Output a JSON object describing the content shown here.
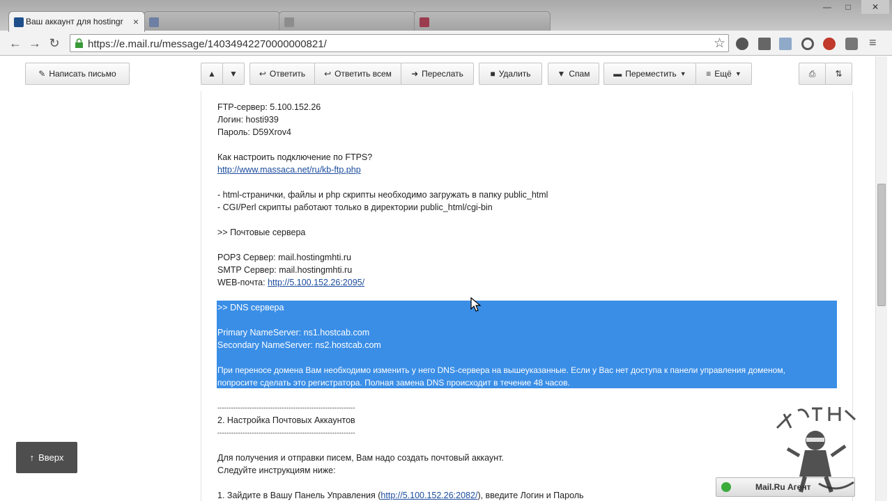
{
  "browser": {
    "active_tab_title": "Ваш аккаунт для hostingr",
    "tab_close": "×",
    "url": "https://e.mail.ru/message/14034942270000000821/"
  },
  "mail_toolbar": {
    "compose": "Написать письмо",
    "reply": "Ответить",
    "reply_all": "Ответить всем",
    "forward": "Переслать",
    "delete": "Удалить",
    "spam": "Спам",
    "move": "Переместить",
    "more": "Ещё"
  },
  "message": {
    "ftp_server": "FTP-сервер: 5.100.152.26",
    "login": "Логин: hosti939",
    "password": "Пароль: D59Xrov4",
    "ftps_question": "Как настроить подключение по FTPS?",
    "ftps_link": "http://www.massaca.net/ru/kb-ftp.php",
    "html_note": "- html-странички, файлы и php скрипты необходимо загружать в папку public_html",
    "cgi_note": "- CGI/Perl скрипты работают только в директории public_html/cgi-bin",
    "mail_servers_heading": ">> Почтовые сервера",
    "pop3": "POP3 Сервер: mail.hostingmhti.ru",
    "smtp": "SMTP Сервер: mail.hostingmhti.ru",
    "webmail_label": "WEB-почта: ",
    "webmail_link": "http://5.100.152.26:2095/",
    "dns_heading": ">> DNS сервера",
    "primary_ns": "Primary NameServer: ns1.hostcab.com",
    "secondary_ns": "Secondary NameServer: ns2.hostcab.com",
    "dns_note_1": "При переносе домена Вам необходимо изменить у него DNS-сервера на вышеуказанные. Если у Вас нет доступа к панели управления доменом,",
    "dns_note_2": "попросите сделать это регистратора. Полная замена DNS происходит в течение 48 часов.",
    "divider": "------------------------------------------------------------",
    "section2_title": "2. Настройка Почтовых Аккаунтов",
    "mail_intro": "Для получения и отправки писем, Вам надо создать почтовый аккаунт.",
    "follow": "Следуйте инструкциям ниже:",
    "step1_prefix": "1. Зайдите в Вашу Панель Управления (",
    "step1_link": "http://5.100.152.26:2082/",
    "step1_suffix": "), введите Логин и Пароль"
  },
  "up_button": "Вверх",
  "up_arrow": "↑",
  "agent": "Mail.Ru Агент",
  "colors": {
    "selection": "#3a8ee6",
    "link": "#1a4b9c"
  },
  "icons": [
    "lock-icon",
    "star-icon",
    "reply-icon",
    "reply-all-icon",
    "forward-icon",
    "trash-icon",
    "thumbs-down-icon",
    "folder-icon",
    "list-icon",
    "print-icon",
    "refresh-icon"
  ]
}
